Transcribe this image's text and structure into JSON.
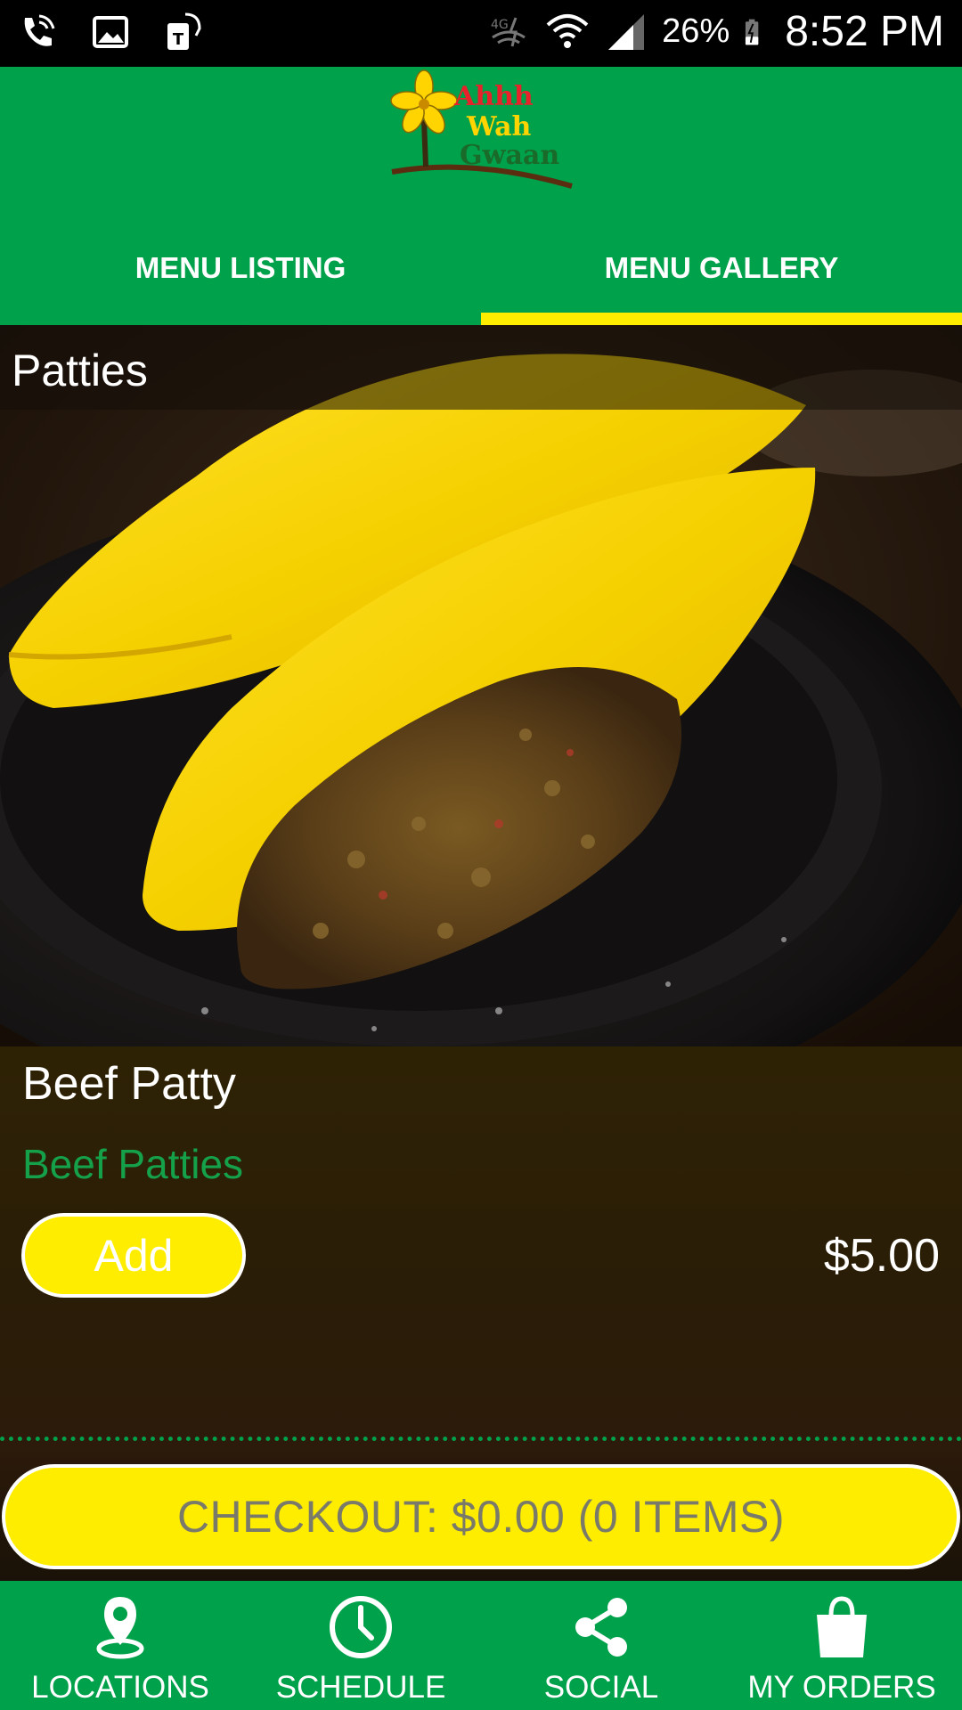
{
  "status_bar": {
    "battery_percent": "26%",
    "time": "8:52 PM",
    "left_icons": [
      "phone-wifi-icon",
      "image-icon",
      "tag-icon"
    ],
    "right_icons": [
      "lte-data-icon",
      "wifi-icon",
      "signal-icon",
      "battery-icon"
    ]
  },
  "header": {
    "logo_lines": [
      "Ahhh",
      "Wah",
      "Gwaan"
    ],
    "tabs": [
      {
        "label": "MENU LISTING",
        "active": false
      },
      {
        "label": "MENU GALLERY",
        "active": true
      }
    ]
  },
  "gallery": {
    "category": "Patties",
    "item": {
      "name": "Beef Patty",
      "description": "Beef Patties",
      "add_label": "Add",
      "price": "$5.00"
    }
  },
  "checkout": {
    "label": "CHECKOUT: $0.00 (0 ITEMS)"
  },
  "bottom_nav": [
    {
      "label": "LOCATIONS",
      "icon": "location-pin-icon"
    },
    {
      "label": "SCHEDULE",
      "icon": "clock-icon"
    },
    {
      "label": "SOCIAL",
      "icon": "share-icon"
    },
    {
      "label": "MY ORDERS",
      "icon": "shopping-bag-icon"
    }
  ],
  "colors": {
    "brand_green": "#00a14b",
    "accent_yellow": "#ffed00",
    "description_green": "#15a04a"
  }
}
